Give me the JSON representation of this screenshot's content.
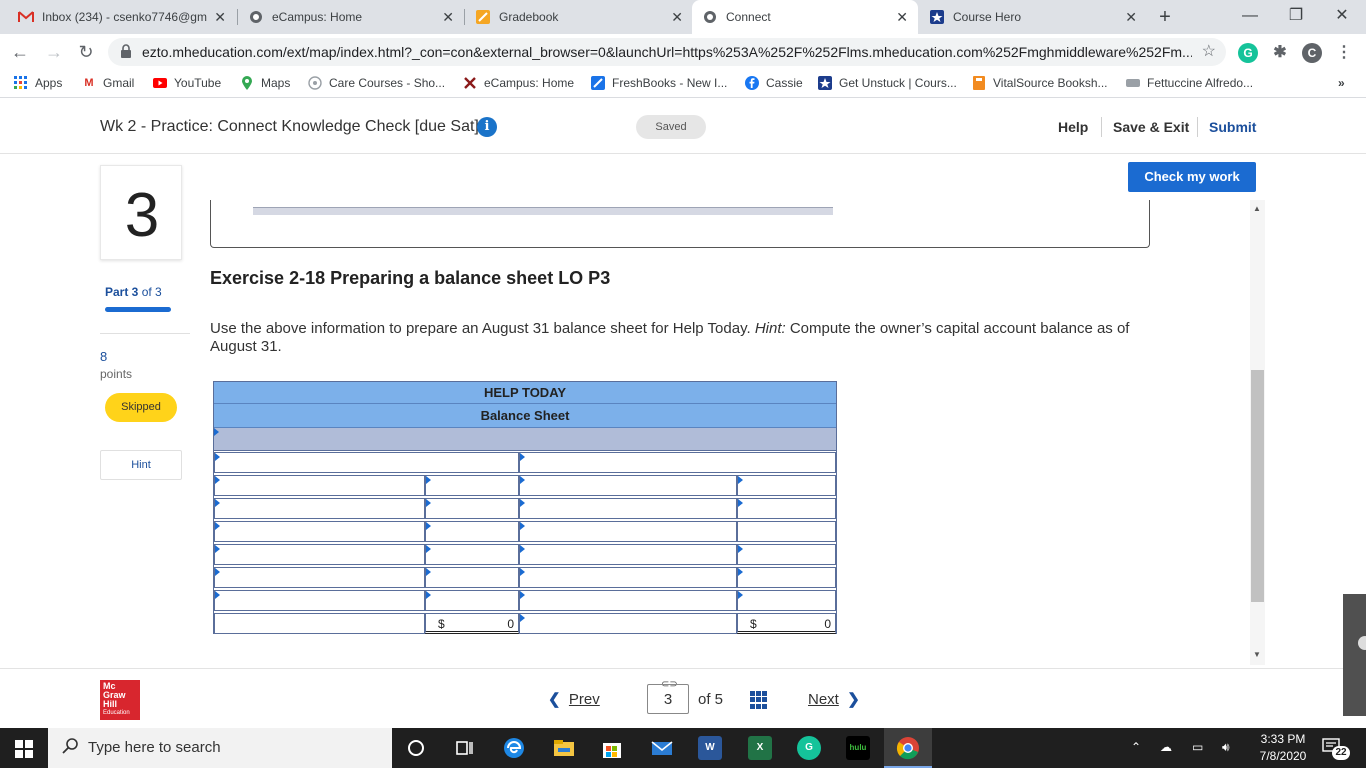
{
  "browser": {
    "tabs": [
      {
        "title": "Inbox (234) - csenko7746@gm",
        "icon": "gmail-icon",
        "active": false
      },
      {
        "title": "eCampus: Home",
        "icon": "globe-icon",
        "active": false
      },
      {
        "title": "Gradebook",
        "icon": "gradebook-icon",
        "active": false
      },
      {
        "title": "Connect",
        "icon": "globe-icon",
        "active": true
      },
      {
        "title": "Course Hero",
        "icon": "coursehero-icon",
        "active": false
      }
    ],
    "url": "ezto.mheducation.com/ext/map/index.html?_con=con&external_browser=0&launchUrl=https%253A%252F%252Flms.mheducation.com%252Fmghmiddleware%252Fm...",
    "profile_initial": "C",
    "bookmarks": [
      {
        "label": "Apps",
        "icon": "apps-grid-icon"
      },
      {
        "label": "Gmail",
        "icon": "gmail-icon"
      },
      {
        "label": "YouTube",
        "icon": "youtube-icon"
      },
      {
        "label": "Maps",
        "icon": "maps-icon"
      },
      {
        "label": "Care Courses - Sho...",
        "icon": "care-icon"
      },
      {
        "label": "eCampus: Home",
        "icon": "ecampus-icon"
      },
      {
        "label": "FreshBooks - New I...",
        "icon": "freshbooks-icon"
      },
      {
        "label": "Cassie",
        "icon": "facebook-icon"
      },
      {
        "label": "Get Unstuck | Cours...",
        "icon": "coursehero-icon"
      },
      {
        "label": "VitalSource Booksh...",
        "icon": "vitalsource-icon"
      },
      {
        "label": "Fettuccine Alfredo...",
        "icon": "recipe-icon"
      }
    ],
    "more_bookmarks": "»"
  },
  "header": {
    "assignment_title": "Wk 2 - Practice: Connect Knowledge Check [due Sat]",
    "save_status": "Saved",
    "help": "Help",
    "save_exit": "Save & Exit",
    "submit": "Submit"
  },
  "question": {
    "number": "3",
    "part_label": "Part 3",
    "part_of": "of 3",
    "points": "8",
    "points_label": "points",
    "status": "Skipped",
    "hint": "Hint",
    "check_label": "Check my work",
    "exercise_title": "Exercise 2-18 Preparing a balance sheet LO P3",
    "instruction_pre": "Use the above information to prepare an August 31 balance sheet for Help Today. ",
    "instruction_hint_label": "Hint:",
    "instruction_post": " Compute the owner’s capital account balance as of August 31."
  },
  "balance_sheet": {
    "company": "HELP TODAY",
    "statement": "Balance Sheet",
    "total_left_currency": "$",
    "total_left_value": "0",
    "total_right_currency": "$",
    "total_right_value": "0"
  },
  "footer": {
    "prev": "Prev",
    "current_page": "3",
    "of_label": "of 5",
    "next": "Next",
    "logo_line1": "Mc",
    "logo_line2": "Graw",
    "logo_line3": "Hill",
    "logo_line4": "Education"
  },
  "taskbar": {
    "search_placeholder": "Type here to search",
    "time": "3:33 PM",
    "date": "7/8/2020",
    "notifications": "22"
  }
}
